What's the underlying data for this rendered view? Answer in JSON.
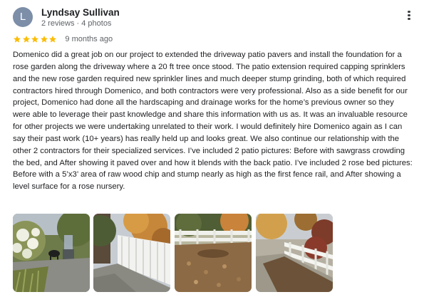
{
  "reviewer": {
    "initial": "L",
    "name": "Lyndsay Sullivan",
    "meta": "2 reviews · 4 photos",
    "avatar_color": "#7c8ea8"
  },
  "rating": {
    "stars": 5,
    "star_color": "#fbbc04"
  },
  "time_ago": "9 months ago",
  "review_text": "Domenico did a great job on our project to extended the driveway patio pavers and install the foundation for a rose garden along the driveway where a 20 ft tree once stood. The patio extension required capping sprinklers and the new rose garden required new sprinkler lines and much deeper stump grinding, both of which required contractors hired through Domenico, and both contractors were very professional. Also as a side benefit for our project, Domenico had done all the hardscaping and drainage works for the home’s previous owner so they were able to leverage their past knowledge and share this information with us as. It was an invaluable resource for other projects we were undertaking unrelated to their work. I would definitely hire Domenico again as I can say their past work (10+ years) has really held up and looks great. We also continue our relationship with the other 2 contractors for their specialized services. I’ve included 2 patio pictures: Before with sawgrass crowding the bed, and After showing it paved over and how it blends with the back patio. I’ve included 2 rose bed pictures: Before with a 5’x3’ area of raw wood chip and stump nearly as high as the first fence rail, and After showing a level surface for a rose nursery.",
  "menu_icon": "more-vert-icon",
  "photos": [
    {
      "icon": "patio-before-photo"
    },
    {
      "icon": "patio-after-photo"
    },
    {
      "icon": "rose-bed-before-photo"
    },
    {
      "icon": "rose-bed-after-photo"
    }
  ]
}
